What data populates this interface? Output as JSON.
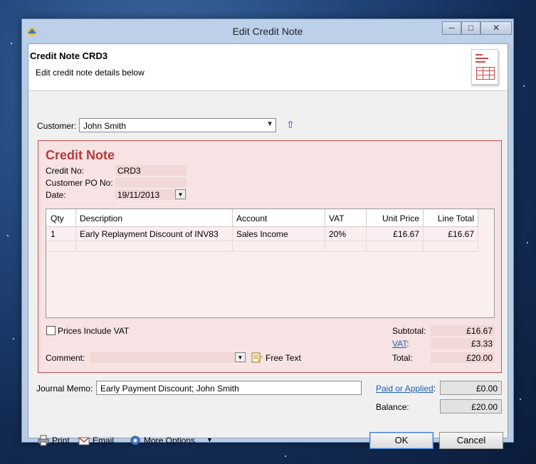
{
  "window": {
    "title": "Edit Credit Note",
    "controls": {
      "minimize": "─",
      "maximize": "□",
      "close": "✕"
    }
  },
  "header": {
    "title": "Credit Note CRD3",
    "subtitle": "Edit credit note details below"
  },
  "customer": {
    "label": "Customer:",
    "value": "John Smith"
  },
  "panel": {
    "title": "Credit Note",
    "fields": {
      "credit_no_label": "Credit No:",
      "credit_no": "CRD3",
      "po_label": "Customer PO No:",
      "po": "",
      "date_label": "Date:",
      "date": "19/11/2013"
    }
  },
  "lines": {
    "columns": [
      "Qty",
      "Description",
      "Account",
      "VAT",
      "Unit Price",
      "Line Total"
    ],
    "rows": [
      {
        "qty": "1",
        "description": "Early Replayment Discount of INV83",
        "account": "Sales Income",
        "vat": "20%",
        "unit_price": "£16.67",
        "line_total": "£16.67"
      }
    ]
  },
  "prices_include_vat": {
    "label": "Prices Include VAT",
    "checked": false
  },
  "comment": {
    "label": "Comment:",
    "value": "",
    "free_text": "Free Text"
  },
  "totals": {
    "subtotal_label": "Subtotal:",
    "subtotal": "£16.67",
    "vat_label": "VAT",
    "vat_suffix": ":",
    "vat": "£3.33",
    "total_label": "Total:",
    "total": "£20.00"
  },
  "journal_memo": {
    "label": "Journal Memo:",
    "value": "Early Payment Discount; John Smith"
  },
  "paid": {
    "label": "Paid or Applied",
    "suffix": ":",
    "value": "£0.00"
  },
  "balance": {
    "label": "Balance:",
    "value": "£20.00"
  },
  "toolbar": {
    "print": "Print",
    "email": "Email",
    "more_options": "More Options"
  },
  "buttons": {
    "ok": "OK",
    "cancel": "Cancel"
  },
  "colors": {
    "panel_bg": "#f7e3e3",
    "panel_border": "#c94f4f",
    "title_red": "#b83b3b",
    "link": "#1f5fb5"
  }
}
